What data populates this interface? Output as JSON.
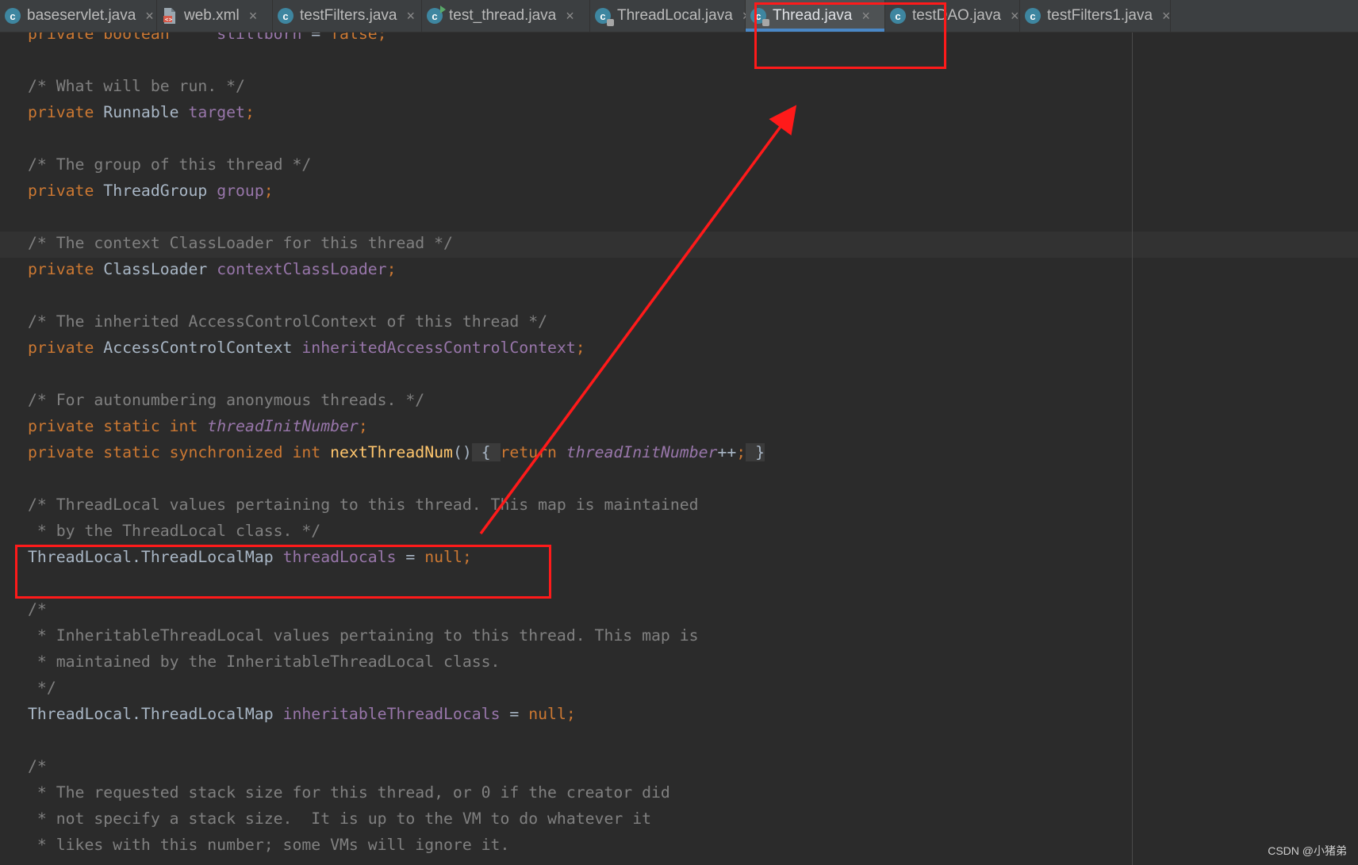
{
  "tabs": [
    {
      "label": "baseservlet.java",
      "icon": "java-class-icon",
      "active": false
    },
    {
      "label": "web.xml",
      "icon": "xml-file-icon",
      "active": false
    },
    {
      "label": "testFilters.java",
      "icon": "java-class-icon",
      "active": false
    },
    {
      "label": "test_thread.java",
      "icon": "java-runnable-class-icon",
      "active": false
    },
    {
      "label": "ThreadLocal.java",
      "icon": "java-class-icon",
      "active": false
    },
    {
      "label": "Thread.java",
      "icon": "java-class-icon",
      "active": true
    },
    {
      "label": "testDAO.java",
      "icon": "java-class-icon",
      "active": false
    },
    {
      "label": "testFilters1.java",
      "icon": "java-class-icon",
      "active": false
    }
  ],
  "code": {
    "lines": [
      [
        [
          "keyword",
          "private boolean"
        ],
        [
          "plain",
          "     "
        ],
        [
          "field",
          "stillborn"
        ],
        [
          "plain",
          " = "
        ],
        [
          "keyword",
          "false;"
        ]
      ],
      [],
      [
        [
          "comment",
          "/* What will be run. */"
        ]
      ],
      [
        [
          "keyword",
          "private "
        ],
        [
          "type",
          "Runnable "
        ],
        [
          "field",
          "target"
        ],
        [
          "punct",
          ";"
        ]
      ],
      [],
      [
        [
          "comment",
          "/* The group of this thread */"
        ]
      ],
      [
        [
          "keyword",
          "private "
        ],
        [
          "type",
          "ThreadGroup "
        ],
        [
          "field",
          "group"
        ],
        [
          "punct",
          ";"
        ]
      ],
      [],
      [
        [
          "comment",
          "/* The context ClassLoader for this thread */"
        ]
      ],
      [
        [
          "keyword",
          "private "
        ],
        [
          "type",
          "ClassLoader "
        ],
        [
          "field",
          "contextClassLoader"
        ],
        [
          "punct",
          ";"
        ]
      ],
      [],
      [
        [
          "comment",
          "/* The inherited AccessControlContext of this thread */"
        ]
      ],
      [
        [
          "keyword",
          "private "
        ],
        [
          "type",
          "AccessControlContext "
        ],
        [
          "field",
          "inheritedAccessControlContext"
        ],
        [
          "punct",
          ";"
        ]
      ],
      [],
      [
        [
          "comment",
          "/* For autonumbering anonymous threads. */"
        ]
      ],
      [
        [
          "keyword",
          "private static int "
        ],
        [
          "static-field",
          "threadInitNumber"
        ],
        [
          "punct",
          ";"
        ]
      ],
      [
        [
          "keyword",
          "private static synchronized int "
        ],
        [
          "method",
          "nextThreadNum"
        ],
        [
          "plain",
          "()"
        ],
        [
          "fold",
          " { "
        ],
        [
          "keyword",
          "return "
        ],
        [
          "static-field",
          "threadInitNumber"
        ],
        [
          "plain",
          "++"
        ],
        [
          "punct",
          ";"
        ],
        [
          "fold",
          " }"
        ]
      ],
      [],
      [
        [
          "comment",
          "/* ThreadLocal values pertaining to this thread. This map is maintained"
        ]
      ],
      [
        [
          "comment",
          " * by the ThreadLocal class. */"
        ]
      ],
      [
        [
          "type",
          "ThreadLocal.ThreadLocalMap "
        ],
        [
          "field",
          "threadLocals"
        ],
        [
          "plain",
          " = "
        ],
        [
          "keyword",
          "null;"
        ]
      ],
      [],
      [
        [
          "comment",
          "/*"
        ]
      ],
      [
        [
          "comment",
          " * InheritableThreadLocal values pertaining to this thread. This map is"
        ]
      ],
      [
        [
          "comment",
          " * maintained by the InheritableThreadLocal class."
        ]
      ],
      [
        [
          "comment",
          " */"
        ]
      ],
      [
        [
          "type",
          "ThreadLocal.ThreadLocalMap "
        ],
        [
          "field",
          "inheritableThreadLocals"
        ],
        [
          "plain",
          " = "
        ],
        [
          "keyword",
          "null;"
        ]
      ],
      [],
      [
        [
          "comment",
          "/*"
        ]
      ],
      [
        [
          "comment",
          " * The requested stack size for this thread, or 0 if the creator did"
        ]
      ],
      [
        [
          "comment",
          " * not specify a stack size.  It is up to the VM to do whatever it"
        ]
      ],
      [
        [
          "comment",
          " * likes with this number; some VMs will ignore it."
        ]
      ]
    ]
  },
  "annotation": {
    "color": "#ff1a1a"
  },
  "watermark": "CSDN @小猪弟"
}
